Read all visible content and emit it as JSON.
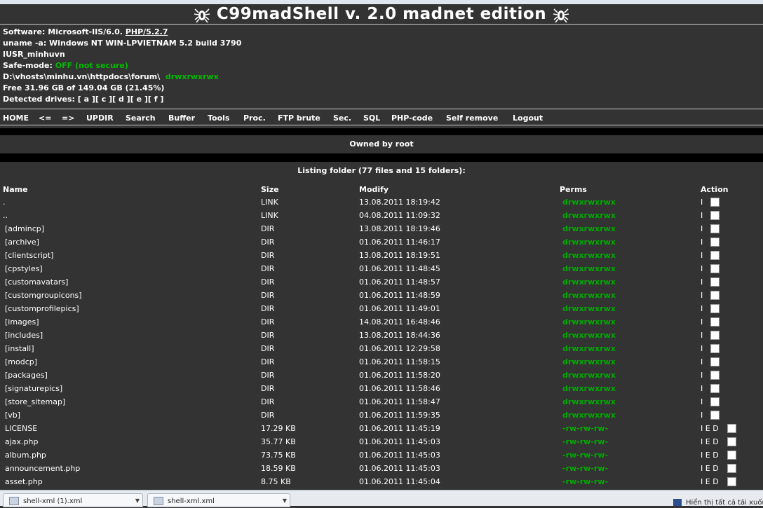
{
  "title": "C99madShell v. 2.0 madnet edition",
  "info": {
    "software_label": "Software:",
    "software_value": "Microsoft-IIS/6.0.",
    "php_link": "PHP/5.2.7",
    "uname": "uname -a: Windows NT WIN-LPVIETNAM 5.2 build 3790",
    "user": "IUSR_minhuvn",
    "safemode_label": "Safe-mode:",
    "safemode_value": "OFF (not secure)",
    "path": "D:\\vhosts\\minhu.vn\\httpdocs\\forum\\",
    "path_perms": "drwxrwxrwx",
    "free": "Free 31.96 GB of 149.04 GB (21.45%)",
    "drives_label": "Detected drives:",
    "drives": [
      "[ a ]",
      "[ c ]",
      "[ d ]",
      "[ e ]",
      "[ f ]"
    ]
  },
  "nav": [
    "HOME",
    "<=",
    "=>",
    "UPDIR",
    "Search",
    "Buffer",
    "Tools",
    "Proc.",
    "FTP brute",
    "Sec.",
    "SQL",
    "PHP-code",
    "Self remove",
    "Logout"
  ],
  "owned": "Owned by root",
  "listing": "Listing folder (77 files and 15 folders):",
  "columns": {
    "name": "Name",
    "size": "Size",
    "modify": "Modify",
    "perms": "Perms",
    "action": "Action"
  },
  "rows": [
    {
      "name": ".",
      "size": "LINK",
      "modify": "13.08.2011 18:19:42",
      "perms": "drwxrwxrwx",
      "action": "I"
    },
    {
      "name": "..",
      "size": "LINK",
      "modify": "04.08.2011 11:09:32",
      "perms": "drwxrwxrwx",
      "action": "I"
    },
    {
      "name": "[admincp]",
      "size": "DIR",
      "modify": "13.08.2011 18:19:46",
      "perms": "drwxrwxrwx",
      "action": "I"
    },
    {
      "name": "[archive]",
      "size": "DIR",
      "modify": "01.06.2011 11:46:17",
      "perms": "drwxrwxrwx",
      "action": "I"
    },
    {
      "name": "[clientscript]",
      "size": "DIR",
      "modify": "13.08.2011 18:19:51",
      "perms": "drwxrwxrwx",
      "action": "I"
    },
    {
      "name": "[cpstyles]",
      "size": "DIR",
      "modify": "01.06.2011 11:48:45",
      "perms": "drwxrwxrwx",
      "action": "I"
    },
    {
      "name": "[customavatars]",
      "size": "DIR",
      "modify": "01.06.2011 11:48:57",
      "perms": "drwxrwxrwx",
      "action": "I"
    },
    {
      "name": "[customgroupicons]",
      "size": "DIR",
      "modify": "01.06.2011 11:48:59",
      "perms": "drwxrwxrwx",
      "action": "I"
    },
    {
      "name": "[customprofilepics]",
      "size": "DIR",
      "modify": "01.06.2011 11:49:01",
      "perms": "drwxrwxrwx",
      "action": "I"
    },
    {
      "name": "[images]",
      "size": "DIR",
      "modify": "14.08.2011 16:48:46",
      "perms": "drwxrwxrwx",
      "action": "I"
    },
    {
      "name": "[includes]",
      "size": "DIR",
      "modify": "13.08.2011 18:44:36",
      "perms": "drwxrwxrwx",
      "action": "I"
    },
    {
      "name": "[install]",
      "size": "DIR",
      "modify": "01.06.2011 12:29:58",
      "perms": "drwxrwxrwx",
      "action": "I"
    },
    {
      "name": "[modcp]",
      "size": "DIR",
      "modify": "01.06.2011 11:58:15",
      "perms": "drwxrwxrwx",
      "action": "I"
    },
    {
      "name": "[packages]",
      "size": "DIR",
      "modify": "01.06.2011 11:58:20",
      "perms": "drwxrwxrwx",
      "action": "I"
    },
    {
      "name": "[signaturepics]",
      "size": "DIR",
      "modify": "01.06.2011 11:58:46",
      "perms": "drwxrwxrwx",
      "action": "I"
    },
    {
      "name": "[store_sitemap]",
      "size": "DIR",
      "modify": "01.06.2011 11:58:47",
      "perms": "drwxrwxrwx",
      "action": "I"
    },
    {
      "name": "[vb]",
      "size": "DIR",
      "modify": "01.06.2011 11:59:35",
      "perms": "drwxrwxrwx",
      "action": "I"
    },
    {
      "name": "LICENSE",
      "size": "17.29 KB",
      "modify": "01.06.2011 11:45:19",
      "perms": "-rw-rw-rw-",
      "action": "I E D"
    },
    {
      "name": "ajax.php",
      "size": "35.77 KB",
      "modify": "01.06.2011 11:45:03",
      "perms": "-rw-rw-rw-",
      "action": "I E D"
    },
    {
      "name": "album.php",
      "size": "73.75 KB",
      "modify": "01.06.2011 11:45:03",
      "perms": "-rw-rw-rw-",
      "action": "I E D"
    },
    {
      "name": "announcement.php",
      "size": "18.59 KB",
      "modify": "01.06.2011 11:45:03",
      "perms": "-rw-rw-rw-",
      "action": "I E D"
    },
    {
      "name": "asset.php",
      "size": "8.75 KB",
      "modify": "01.06.2011 11:45:04",
      "perms": "-rw-rw-rw-",
      "action": "I E D"
    }
  ],
  "taskbar": {
    "tab1": "shell-xml (1).xml",
    "tab2": "shell-xml.xml",
    "tray": "Hiển thị tất cả tải xuống"
  },
  "colors": {
    "background": "#333333",
    "perms_green": "#00aa00",
    "safe_green": "#00bb00"
  }
}
